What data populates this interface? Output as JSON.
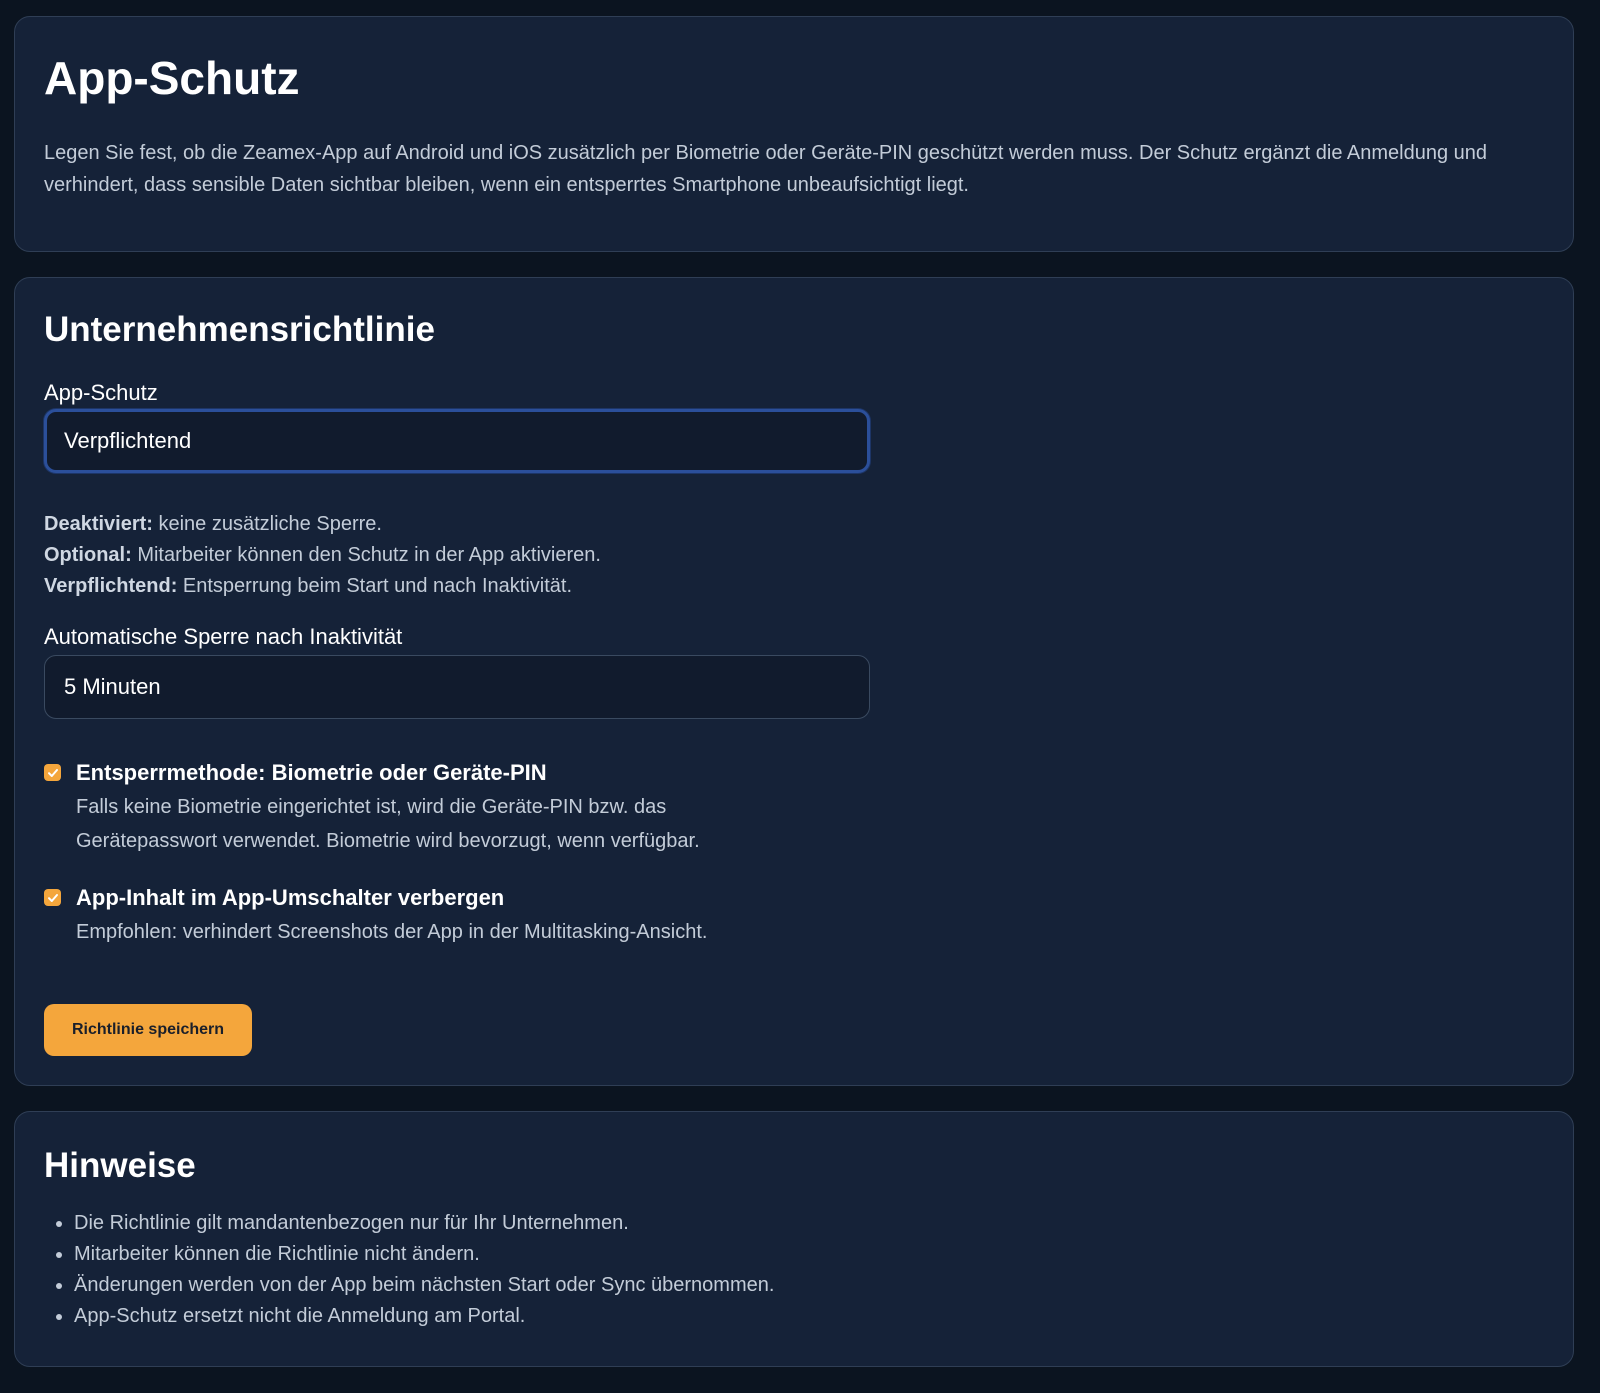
{
  "intro": {
    "title": "App-Schutz",
    "description": "Legen Sie fest, ob die Zeamex-App auf Android und iOS zusätzlich per Biometrie oder Geräte-PIN geschützt werden muss. Der Schutz ergänzt die Anmeldung und verhindert, dass sensible Daten sichtbar bleiben, wenn ein entsperrtes Smartphone unbeaufsichtigt liegt."
  },
  "policy": {
    "title": "Unternehmensrichtlinie",
    "app_protection": {
      "label": "App-Schutz",
      "value": "Verpflichtend"
    },
    "help": [
      {
        "term": "Deaktiviert:",
        "text": " keine zusätzliche Sperre."
      },
      {
        "term": "Optional:",
        "text": " Mitarbeiter können den Schutz in der App aktivieren."
      },
      {
        "term": "Verpflichtend:",
        "text": " Entsperrung beim Start und nach Inaktivität."
      }
    ],
    "auto_lock": {
      "label": "Automatische Sperre nach Inaktivität",
      "value": "5 Minuten"
    },
    "checkboxes": [
      {
        "title": "Entsperrmethode: Biometrie oder Geräte-PIN",
        "description": "Falls keine Biometrie eingerichtet ist, wird die Geräte-PIN bzw. das Gerätepasswort verwendet. Biometrie wird bevorzugt, wenn verfügbar.",
        "checked": true
      },
      {
        "title": "App-Inhalt im App-Umschalter verbergen",
        "description": "Empfohlen: verhindert Screenshots der App in der Multitasking-Ansicht.",
        "checked": true
      }
    ],
    "save_label": "Richtlinie speichern"
  },
  "notes": {
    "title": "Hinweise",
    "items": [
      "Die Richtlinie gilt mandantenbezogen nur für Ihr Unternehmen.",
      "Mitarbeiter können die Richtlinie nicht ändern.",
      "Änderungen werden von der App beim nächsten Start oder Sync übernommen.",
      "App-Schutz ersetzt nicht die Anmeldung am Portal."
    ]
  },
  "colors": {
    "background": "#0b1420",
    "card": "#152238",
    "accent": "#f4a63c",
    "focus_border": "#2b4f9a"
  }
}
